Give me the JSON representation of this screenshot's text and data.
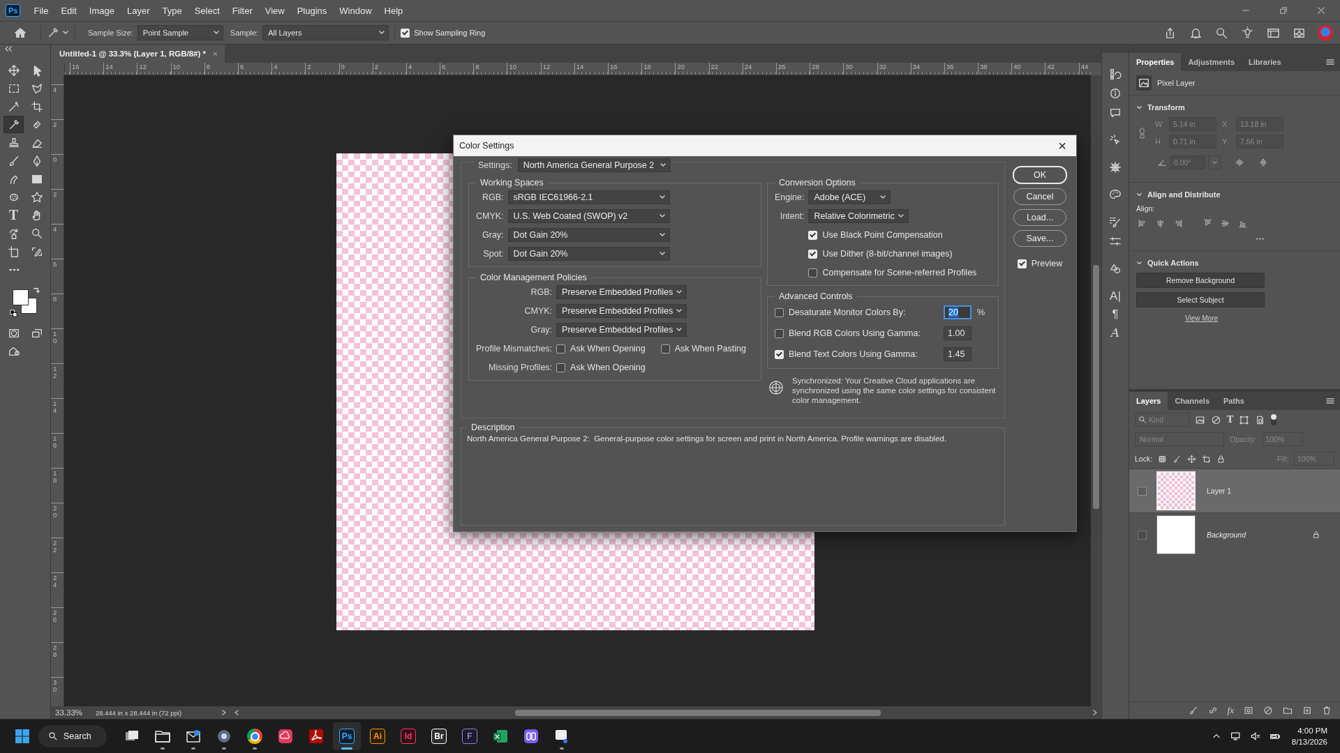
{
  "app": {
    "logo": "Ps"
  },
  "menu": [
    "File",
    "Edit",
    "Image",
    "Layer",
    "Type",
    "Select",
    "Filter",
    "View",
    "Plugins",
    "Window",
    "Help"
  ],
  "options_bar": {
    "sample_size_label": "Sample Size:",
    "sample_size": "Point Sample",
    "sample_label": "Sample:",
    "sample": "All Layers",
    "sampling_ring": {
      "label": "Show Sampling Ring",
      "checked": true
    }
  },
  "document_tab": {
    "title": "Untitled-1 @ 33.3% (Layer 1, RGB/8#) *",
    "close": "×"
  },
  "rulers": {
    "horizontal": [
      "16",
      "14",
      "12",
      "10",
      "8",
      "6",
      "4",
      "2",
      "0",
      "2",
      "4",
      "6",
      "8",
      "10",
      "12",
      "14",
      "16",
      "18",
      "20",
      "22",
      "24",
      "26",
      "28",
      "30",
      "32",
      "34",
      "36",
      "38",
      "40",
      "42",
      "44"
    ],
    "vertical": [
      "4",
      "2",
      "0",
      "2",
      "4",
      "6",
      "8",
      "10",
      "12",
      "14",
      "16",
      "18",
      "20",
      "22",
      "24",
      "26",
      "28",
      "30"
    ]
  },
  "tools": [
    {
      "selected": false
    },
    {
      "selected": false
    },
    {
      "selected": false
    },
    {
      "selected": false
    },
    {
      "selected": false
    },
    {
      "selected": false
    },
    {
      "selected": true
    },
    {
      "selected": false
    },
    {
      "selected": false
    },
    {
      "selected": false
    },
    {
      "selected": false
    },
    {
      "selected": false
    },
    {
      "selected": false
    },
    {
      "selected": false
    },
    {
      "selected": false
    },
    {
      "selected": false
    },
    {
      "selected": false,
      "glyph": "T"
    },
    {
      "selected": false
    },
    {
      "selected": false
    },
    {
      "selected": false
    },
    {
      "selected": false
    },
    {
      "selected": false
    },
    {
      "selected": false
    }
  ],
  "right_strip": {
    "glyphs": [
      "A|",
      "¶",
      "A"
    ]
  },
  "properties": {
    "tabs": [
      {
        "label": "Properties",
        "selected": true
      },
      {
        "label": "Adjustments",
        "selected": false
      },
      {
        "label": "Libraries",
        "selected": false
      }
    ],
    "layer_type": "Pixel Layer",
    "transform": {
      "title": "Transform",
      "disabled": true,
      "fields": [
        {
          "label": "W",
          "value": "5.14 in"
        },
        {
          "label": "X",
          "value": "13.18 in"
        },
        {
          "label": "H",
          "value": "0.71 in"
        },
        {
          "label": "Y",
          "value": "7.56 in"
        }
      ],
      "angle": "0.00°"
    },
    "align": {
      "title": "Align and Distribute",
      "label": "Align:"
    },
    "quick_actions": {
      "title": "Quick Actions",
      "buttons": [
        "Remove Background",
        "Select Subject"
      ],
      "link": "View More"
    }
  },
  "layers": {
    "tabs": [
      {
        "label": "Layers",
        "selected": true
      },
      {
        "label": "Channels",
        "selected": false
      },
      {
        "label": "Paths",
        "selected": false
      }
    ],
    "filter": {
      "placeholder": "Kind",
      "type_glyph": "T"
    },
    "blend_mode": "Normal",
    "opacity_label": "Opacity:",
    "opacity": "100%",
    "lock_label": "Lock:",
    "fill_label": "Fill:",
    "fill": "100%",
    "items": [
      {
        "name": "Layer 1",
        "kind": "layer",
        "selected": true,
        "locked": false
      },
      {
        "name": "Background",
        "kind": "background",
        "selected": false,
        "locked": true
      }
    ],
    "footer_fx": "fx"
  },
  "status_bar": {
    "zoom": "33.33%",
    "doc_size": "28.444 in x 28.444 in (72 ppi)"
  },
  "dialog": {
    "title": "Color Settings",
    "close": "×",
    "settings": {
      "label": "Settings:",
      "value": "North America General Purpose 2"
    },
    "working_spaces": {
      "title": "Working Spaces",
      "rows": [
        {
          "label": "RGB:",
          "value": "sRGB IEC61966-2.1"
        },
        {
          "label": "CMYK:",
          "value": "U.S. Web Coated (SWOP) v2"
        },
        {
          "label": "Gray:",
          "value": "Dot Gain 20%"
        },
        {
          "label": "Spot:",
          "value": "Dot Gain 20%"
        }
      ]
    },
    "policies": {
      "title": "Color Management Policies",
      "rows": [
        {
          "label": "RGB:",
          "value": "Preserve Embedded Profiles"
        },
        {
          "label": "CMYK:",
          "value": "Preserve Embedded Profiles"
        },
        {
          "label": "Gray:",
          "value": "Preserve Embedded Profiles"
        }
      ],
      "checks": [
        {
          "label": "Profile Mismatches:",
          "options": [
            {
              "label": "Ask When Opening",
              "checked": false
            },
            {
              "label": "Ask When Pasting",
              "checked": false
            }
          ]
        },
        {
          "label": "Missing Profiles:",
          "options": [
            {
              "label": "Ask When Opening",
              "checked": false
            }
          ]
        }
      ]
    },
    "conversion": {
      "title": "Conversion Options",
      "rows": [
        {
          "label": "Engine:",
          "value": "Adobe (ACE)"
        },
        {
          "label": "Intent:",
          "value": "Relative Colorimetric"
        }
      ],
      "options": [
        {
          "label": "Use Black Point Compensation",
          "checked": true
        },
        {
          "label": "Use Dither (8-bit/channel images)",
          "checked": true
        },
        {
          "label": "Compensate for Scene-referred Profiles",
          "checked": false
        }
      ]
    },
    "advanced": {
      "title": "Advanced Controls",
      "rows": [
        {
          "label": "Desaturate Monitor Colors By:",
          "checked": false,
          "value": "20",
          "unit": "%",
          "highlighted": true
        },
        {
          "label": "Blend RGB Colors Using Gamma:",
          "checked": false,
          "value": "1.00",
          "highlighted": false
        },
        {
          "label": "Blend Text Colors Using Gamma:",
          "checked": true,
          "value": "1.45",
          "highlighted": false
        }
      ]
    },
    "sync_note": "Synchronized: Your Creative Cloud applications are synchronized using the same color settings for consistent color management.",
    "description": {
      "title": "Description",
      "text": "North America General Purpose 2:  General-purpose color settings for screen and print in North America. Profile warnings are disabled."
    },
    "buttons": [
      {
        "label": "OK",
        "default": true
      },
      {
        "label": "Cancel",
        "default": false
      },
      {
        "label": "Load...",
        "default": false
      },
      {
        "label": "Save...",
        "default": false
      }
    ],
    "preview": {
      "label": "Preview",
      "checked": true
    }
  },
  "taskbar": {
    "search": "Search",
    "apps": [
      {
        "kind": "task-view",
        "running": false
      },
      {
        "kind": "folder",
        "running": true
      },
      {
        "kind": "mail",
        "running": true
      },
      {
        "kind": "gear",
        "running": true
      },
      {
        "kind": "browser",
        "running": true
      },
      {
        "kind": "cloud",
        "running": false
      },
      {
        "kind": "acrobat",
        "running": false
      },
      {
        "kind": "letters",
        "label": "Ps",
        "color": "#31a8ff",
        "running": true,
        "active": true
      },
      {
        "kind": "letters",
        "label": "Ai",
        "color": "#ff9a00",
        "running": false
      },
      {
        "kind": "letters",
        "label": "Id",
        "color": "#ff3366",
        "running": false
      },
      {
        "kind": "letters",
        "label": "Br",
        "color": "#ffffff",
        "running": false
      },
      {
        "kind": "letters",
        "label": "F",
        "color": "#8f7fe0",
        "running": false
      },
      {
        "kind": "sheet",
        "running": false
      },
      {
        "kind": "purple",
        "running": false
      },
      {
        "kind": "snip",
        "running": true
      }
    ],
    "time": "4:00 PM",
    "date": "8/13/2026"
  }
}
